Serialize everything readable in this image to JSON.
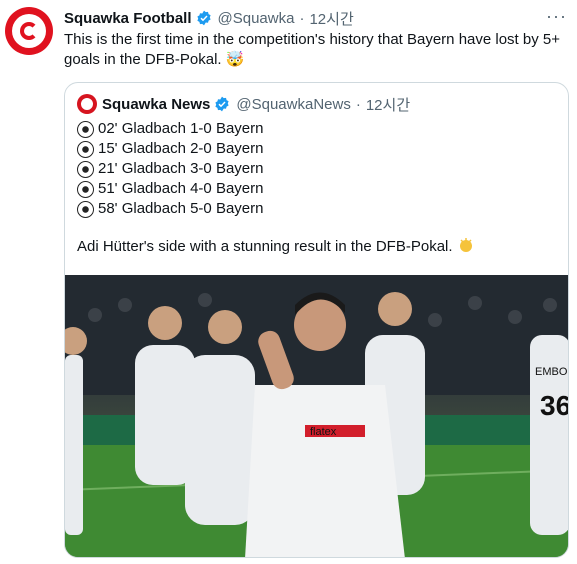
{
  "tweet": {
    "author_name": "Squawka Football",
    "handle": "@Squawka",
    "time": "12시간",
    "more_label": "···",
    "text": "This is the first time in the competition's history that Bayern have lost by 5+ goals in the DFB-Pokal. 🤯"
  },
  "quote": {
    "author_name": "Squawka News",
    "handle": "@SquawkaNews",
    "time": "12시간",
    "goals": [
      "02' Gladbach 1-0 Bayern",
      "15' Gladbach 2-0 Bayern",
      "21' Gladbach 3-0 Bayern",
      "51' Gladbach 4-0 Bayern",
      "58' Gladbach 5-0 Bayern"
    ],
    "description": "Adi Hütter's side with a stunning result in the DFB-Pokal.",
    "image": {
      "sponsor_text": "flatex",
      "jersey_text": "EMBO",
      "jersey_number": "36"
    }
  },
  "colors": {
    "brand_red": "#e0121f",
    "verified_blue": "#1d9bf0",
    "muted": "#536471",
    "border": "#cfd9de"
  },
  "icons": [
    "verified-badge-icon",
    "more-icon",
    "football-icon",
    "clapping-hands-icon",
    "exploding-head-emoji"
  ]
}
